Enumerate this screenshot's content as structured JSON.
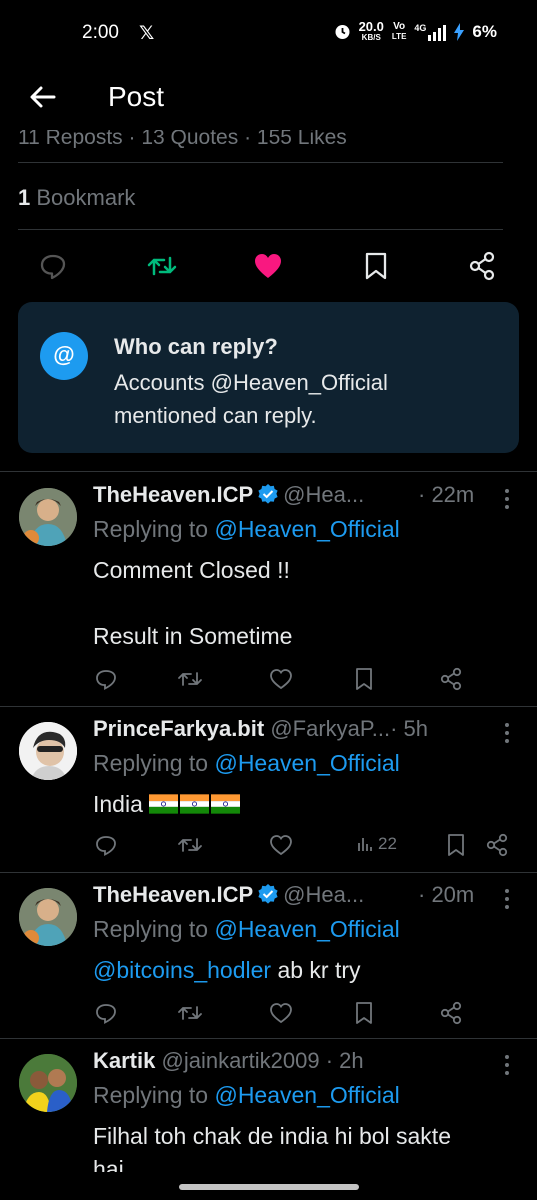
{
  "status": {
    "time": "2:00",
    "x_logo": "𝕏",
    "speed_value": "20.0",
    "speed_unit": "KB/S",
    "net_top": "Vo",
    "net_bottom": "LTE",
    "net_type": "4G",
    "battery": "6%"
  },
  "header": {
    "title": "Post"
  },
  "stats_cut": "11 Reposts · 13 Quotes · 155 Likes",
  "bookmarks": {
    "count": "1",
    "label": "Bookmark"
  },
  "action_bar": {
    "icons": [
      "reply-icon",
      "repost-icon",
      "like-icon",
      "bookmark-icon",
      "share-icon"
    ],
    "repost_color": "#00ba7c",
    "like_color": "#f91880"
  },
  "who_can_reply": {
    "at_symbol": "@",
    "title": "Who can reply?",
    "desc_line1": "Accounts @Heaven_Official",
    "desc_line2": "mentioned can reply."
  },
  "replies": [
    {
      "name": "TheHeaven.ICP",
      "handle": "@Hea...",
      "time": "· 22m",
      "replying_prefix": "Replying to",
      "replying_to": "@Heaven_Official",
      "line1": "Comment Closed !!",
      "line2": "Result in Sometime"
    },
    {
      "name": "PrinceFarkya.bit",
      "handle": "@FarkyaP...",
      "time": "· 5h",
      "replying_prefix": "Replying to",
      "replying_to": "@Heaven_Official",
      "line1": "India",
      "views": "22"
    },
    {
      "name": "TheHeaven.ICP",
      "handle": "@Hea...",
      "time": "· 20m",
      "replying_prefix": "Replying to",
      "replying_to": "@Heaven_Official",
      "mention": "@bitcoins_hodler",
      "line1_rest": " ab kr try"
    },
    {
      "name": "Kartik",
      "handle": "@jainkartik2009",
      "time": "· 2h",
      "replying_prefix": "Replying to",
      "replying_to": "@Heaven_Official",
      "line1": "Filhal toh chak de india hi bol sakte",
      "line2": "hai"
    }
  ],
  "colors": {
    "accent": "#1d9bf0",
    "muted": "#71767b",
    "text": "#e7e9ea",
    "card": "#0f2230"
  }
}
